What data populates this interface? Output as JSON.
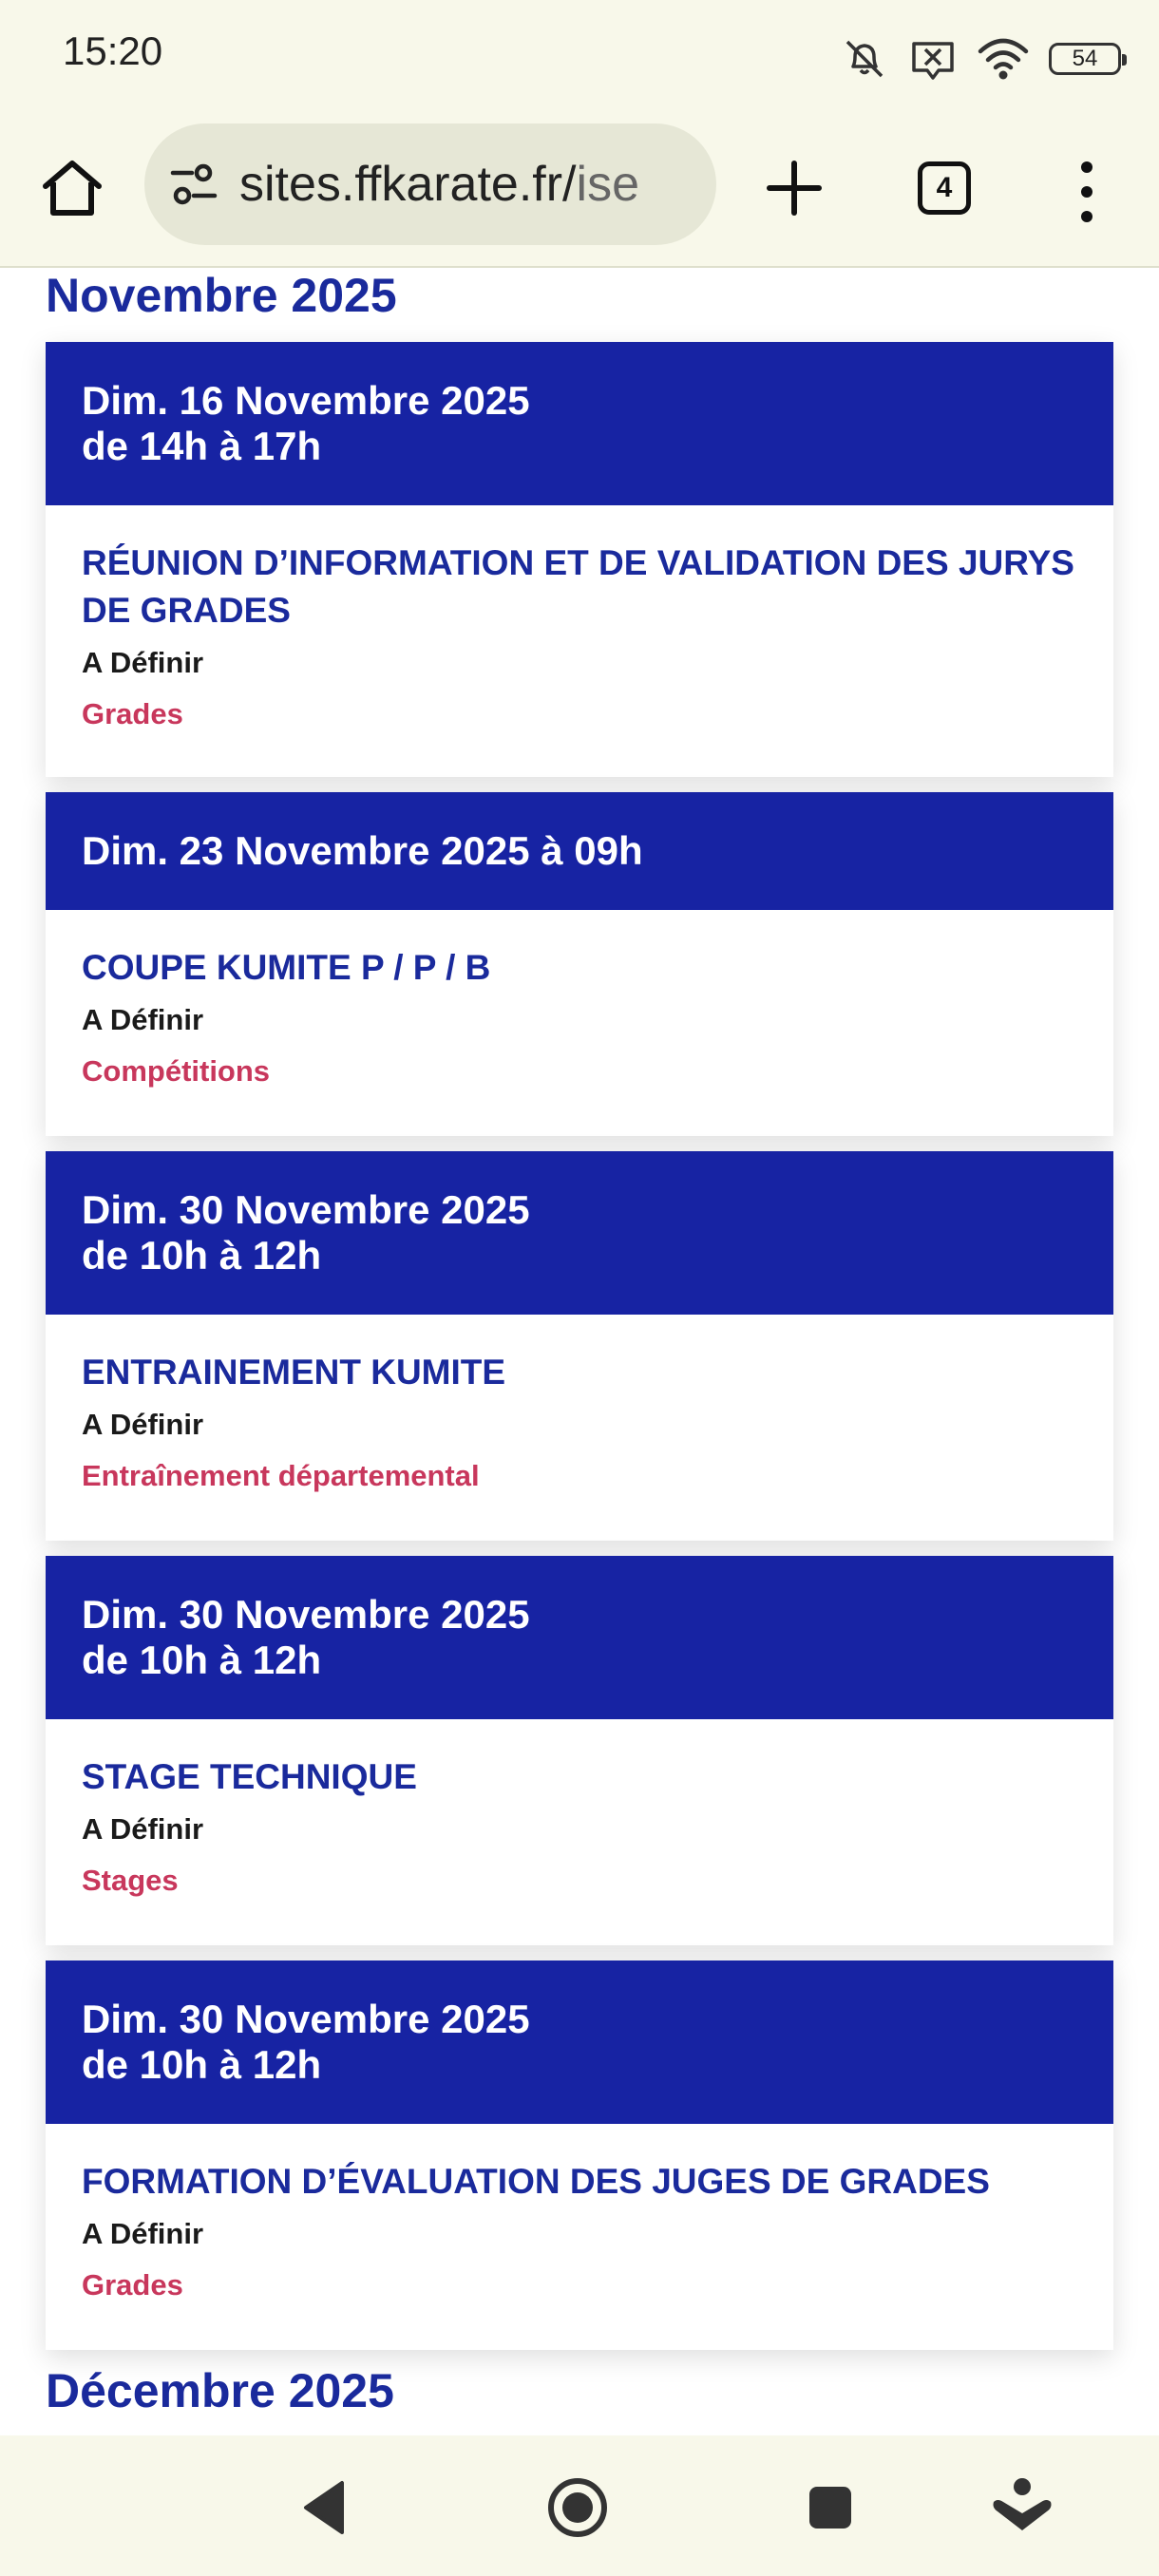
{
  "status_bar": {
    "time": "15:20",
    "battery": "54",
    "icons": [
      "mute-icon",
      "notification-off-icon",
      "wifi-icon",
      "battery-icon"
    ]
  },
  "browser": {
    "url_main": "sites.ffkarate.fr/",
    "url_dim": "ise",
    "tab_count": "4"
  },
  "events": {
    "months": [
      "Novembre 2025",
      "Décembre 2025"
    ],
    "items": [
      {
        "date": "Dim. 16 Novembre 2025",
        "time": "de 14h à 17h",
        "title": "RÉUNION D’INFORMATION ET DE VALIDATION DES JURYS DE GRADES",
        "location": "A Définir",
        "category": "Grades"
      },
      {
        "date": "Dim. 23 Novembre 2025 à 09h",
        "time": "",
        "title": "COUPE KUMITE P / P / B",
        "location": "A Définir",
        "category": "Compétitions"
      },
      {
        "date": "Dim. 30 Novembre 2025",
        "time": "de 10h à 12h",
        "title": "ENTRAINEMENT KUMITE",
        "location": "A Définir",
        "category": "Entraînement départemental"
      },
      {
        "date": "Dim. 30 Novembre 2025",
        "time": "de 10h à 12h",
        "title": "STAGE TECHNIQUE",
        "location": "A Définir",
        "category": "Stages"
      },
      {
        "date": "Dim. 30 Novembre 2025",
        "time": "de 10h à 12h",
        "title": "FORMATION D’ÉVALUATION DES JUGES DE GRADES",
        "location": "A Définir",
        "category": "Grades"
      }
    ]
  },
  "colors": {
    "header_blue": "#1723a3",
    "title_blue": "#1a2a9c",
    "category_red": "#c8375c",
    "chrome_bg": "#f8f8ea"
  }
}
